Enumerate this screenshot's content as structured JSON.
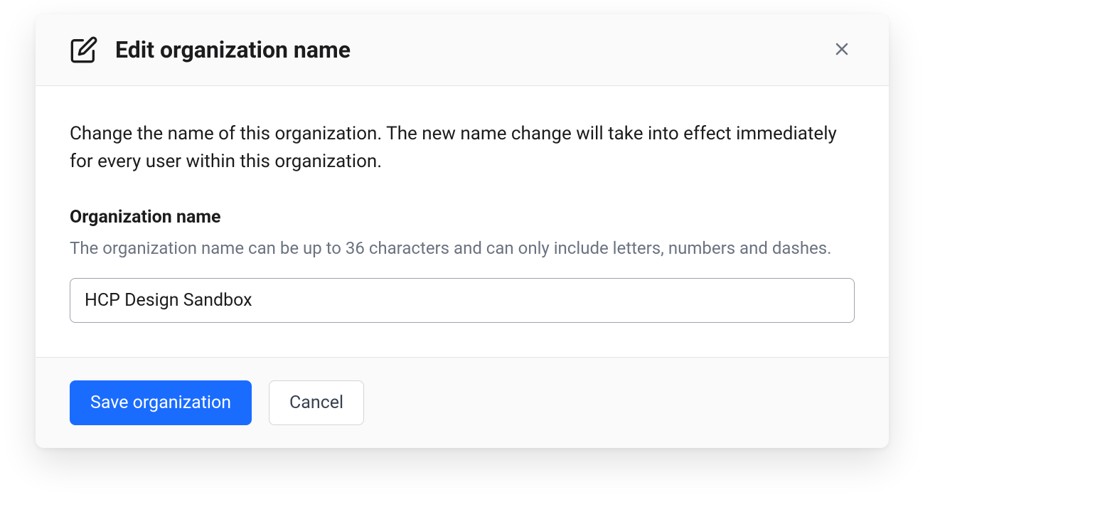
{
  "modal": {
    "title": "Edit organization name",
    "description": "Change the name of this organization. The new name change will take into effect immediately for every user within this organization.",
    "field": {
      "label": "Organization name",
      "help": "The organization name can be up to 36 characters and can only include letters, numbers and dashes.",
      "value": "HCP Design Sandbox"
    },
    "actions": {
      "save": "Save organization",
      "cancel": "Cancel"
    }
  }
}
